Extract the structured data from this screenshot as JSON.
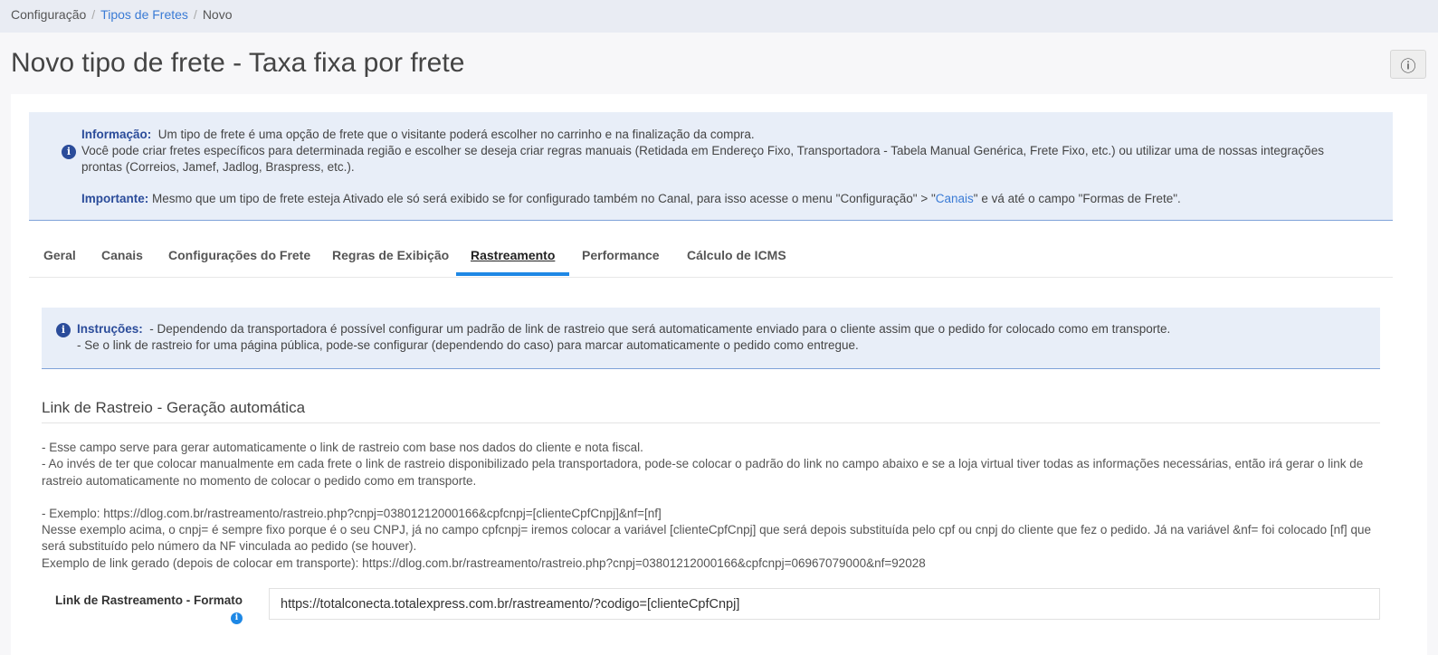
{
  "breadcrumb": {
    "items": [
      "Configuração",
      "Tipos de Fretes",
      "Novo"
    ]
  },
  "page": {
    "title": "Novo tipo de frete - Taxa fixa por frete",
    "info_button_icon": "ⓘ"
  },
  "info_alert": {
    "label": "Informação:",
    "text1": "Um tipo de frete é uma opção de frete que o visitante poderá escolher no carrinho e na finalização da compra.",
    "text2": "Você pode criar fretes específicos para determinada região e escolher se deseja criar regras manuais (Retidada em Endereço Fixo, Transportadora - Tabela Manual Genérica, Frete Fixo, etc.) ou utilizar uma de nossas integrações prontas (Correios, Jamef, Jadlog, Braspress, etc.).",
    "important_label": "Importante:",
    "important_text_a": "Mesmo que um tipo de frete esteja Ativado ele só será exibido se for configurado também no Canal, para isso acesse o menu \"Configuração\" > \"",
    "important_link": "Canais",
    "important_text_b": "\" e vá até o campo \"Formas de Frete\"."
  },
  "tabs": [
    "Geral",
    "Canais",
    "Configurações do Frete",
    "Regras de Exibição",
    "Rastreamento",
    "Performance",
    "Cálculo de ICMS"
  ],
  "active_tab": "Rastreamento",
  "instructions_alert": {
    "label": "Instruções:",
    "line1": "- Dependendo da transportadora é possível configurar um padrão de link de rastreio que será automaticamente enviado para o cliente assim que o pedido for colocado como em transporte.",
    "line2": "- Se o link de rastreio for uma página pública, pode-se configurar (dependendo do caso) para marcar automaticamente o pedido como entregue."
  },
  "section": {
    "title": "Link de Rastreio - Geração automática",
    "desc1": "- Esse campo serve para gerar automaticamente o link de rastreio com base nos dados do cliente e nota fiscal.",
    "desc2": "- Ao invés de ter que colocar manualmente em cada frete o link de rastreio disponibilizado pela transportadora, pode-se colocar o padrão do link no campo abaixo e se a loja virtual tiver todas as informações necessárias, então irá gerar o link de rastreio automaticamente no momento de colocar o pedido como em transporte.",
    "example": "- Exemplo: https://dlog.com.br/rastreamento/rastreio.php?cnpj=03801212000166&cpfcnpj=[clienteCpfCnpj]&nf=[nf]",
    "example_explain": "Nesse exemplo acima, o cnpj= é sempre fixo porque é o seu CNPJ, já no campo cpfcnpj= iremos colocar a variável [clienteCpfCnpj] que será depois substituída pelo cpf ou cnpj do cliente que fez o pedido. Já na variável &nf= foi colocado [nf] que será substituído pelo número da NF vinculada ao pedido (se houver).",
    "example_generated": "Exemplo de link gerado (depois de colocar em transporte): https://dlog.com.br/rastreamento/rastreio.php?cnpj=03801212000166&cpfcnpj=06967079000&nf=92028"
  },
  "field": {
    "label": "Link de Rastreamento - Formato",
    "value": "https://totalconecta.totalexpress.com.br/rastreamento/?codigo=[clienteCpfCnpj]",
    "help_icon": "info-icon"
  },
  "colors": {
    "accent": "#1e88e5",
    "alert_bg": "#e8eef8",
    "alert_label": "#2b4c9a",
    "link": "#3a7bd5"
  }
}
